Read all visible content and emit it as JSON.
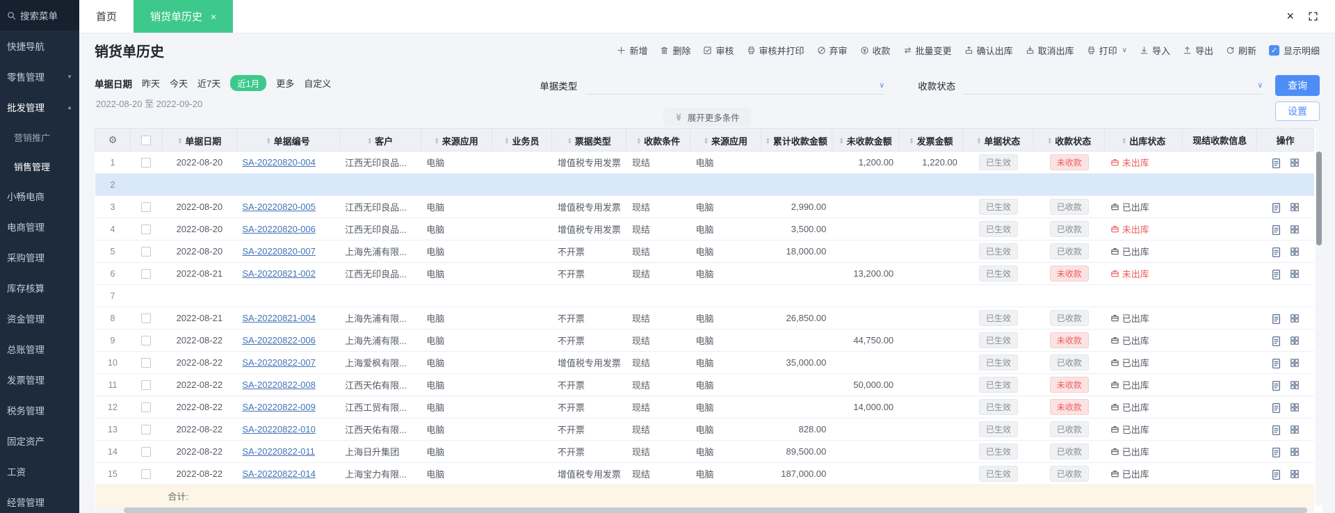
{
  "colors": {
    "green": "#3dc98c",
    "blue": "#4e8df6",
    "red": "#ef5d5d",
    "sidebar_bg": "#1e2b3c"
  },
  "sidebar": {
    "items": [
      {
        "name": "search-menu",
        "label": "搜索菜单",
        "icon": "search"
      },
      {
        "name": "quick-nav",
        "label": "快捷导航"
      },
      {
        "name": "retail-management",
        "label": "零售管理",
        "arrow": "down"
      },
      {
        "name": "wholesale-management",
        "label": "批发管理",
        "arrow": "up",
        "expanded": true
      },
      {
        "name": "marketing-promotion",
        "label": "营销推广",
        "sub": true
      },
      {
        "name": "sales-management",
        "label": "销售管理",
        "sub": true,
        "active": true
      },
      {
        "name": "xiaochang-ecommerce",
        "label": "小畅电商"
      },
      {
        "name": "ecommerce-management",
        "label": "电商管理"
      },
      {
        "name": "procurement-management",
        "label": "采购管理"
      },
      {
        "name": "inventory-accounting",
        "label": "库存核算"
      },
      {
        "name": "funds-management",
        "label": "资金管理"
      },
      {
        "name": "general-ledger",
        "label": "总账管理"
      },
      {
        "name": "invoice-management",
        "label": "发票管理"
      },
      {
        "name": "tax-management",
        "label": "税务管理"
      },
      {
        "name": "fixed-assets",
        "label": "固定资产"
      },
      {
        "name": "payroll",
        "label": "工资"
      },
      {
        "name": "business-management",
        "label": "经营管理"
      }
    ]
  },
  "tabs": {
    "home": "首页",
    "active": "销货单历史"
  },
  "page": {
    "title": "销货单历史",
    "toolbar": [
      {
        "name": "new",
        "label": "新增",
        "icon": "plus"
      },
      {
        "name": "delete",
        "label": "删除",
        "icon": "trash"
      },
      {
        "name": "audit",
        "label": "审核",
        "icon": "audit"
      },
      {
        "name": "audit-print",
        "label": "审核并打印",
        "icon": "audit-print"
      },
      {
        "name": "unaudit",
        "label": "弃审",
        "icon": "discard"
      },
      {
        "name": "receive-payment",
        "label": "收款",
        "icon": "money"
      },
      {
        "name": "batch-change",
        "label": "批量变更",
        "icon": "batch"
      },
      {
        "name": "confirm-outbound",
        "label": "确认出库",
        "icon": "outbound"
      },
      {
        "name": "cancel-outbound",
        "label": "取消出库",
        "icon": "cancel-outbound"
      },
      {
        "name": "print",
        "label": "打印",
        "icon": "printer",
        "dropdown": true
      },
      {
        "name": "import",
        "label": "导入",
        "icon": "import"
      },
      {
        "name": "export",
        "label": "导出",
        "icon": "export"
      },
      {
        "name": "refresh",
        "label": "刷新",
        "icon": "refresh"
      }
    ],
    "show_detail": "显示明细"
  },
  "filters": {
    "date_label": "单据日期",
    "quick_options": [
      {
        "name": "yesterday",
        "label": "昨天"
      },
      {
        "name": "today",
        "label": "今天"
      },
      {
        "name": "last-7-days",
        "label": "近7天"
      },
      {
        "name": "last-1-month",
        "label": "近1月",
        "active": true
      },
      {
        "name": "more",
        "label": "更多"
      },
      {
        "name": "custom",
        "label": "自定义"
      }
    ],
    "date_range": "2022-08-20 至 2022-09-20",
    "doc_type_label": "单据类型",
    "pay_status_label": "收款状态",
    "query_button": "查询",
    "settings_button": "设置",
    "expand_more": "展开更多条件"
  },
  "table": {
    "columns": [
      {
        "name": "doc-date",
        "label": "单据日期",
        "sortable": true
      },
      {
        "name": "doc-no",
        "label": "单据编号",
        "sortable": true
      },
      {
        "name": "customer",
        "label": "客户",
        "sortable": true
      },
      {
        "name": "source-app",
        "label": "来源应用",
        "sortable": true
      },
      {
        "name": "salesman",
        "label": "业务员",
        "sortable": true
      },
      {
        "name": "bill-type",
        "label": "票据类型",
        "sortable": true
      },
      {
        "name": "payment-terms",
        "label": "收款条件",
        "sortable": true
      },
      {
        "name": "source-app-2",
        "label": "来源应用",
        "sortable": true
      },
      {
        "name": "cumulative-received",
        "label": "累计收款金额",
        "sortable": true
      },
      {
        "name": "unreceived",
        "label": "未收款金额",
        "sortable": true
      },
      {
        "name": "invoice-amount",
        "label": "发票金额",
        "sortable": true
      },
      {
        "name": "doc-status",
        "label": "单据状态",
        "sortable": true
      },
      {
        "name": "pay-status",
        "label": "收款状态",
        "sortable": true
      },
      {
        "name": "outbound-status",
        "label": "出库状态",
        "sortable": true
      },
      {
        "name": "cash-info",
        "label": "现结收款信息",
        "sortable": false
      },
      {
        "name": "actions",
        "label": "操作",
        "sortable": false
      }
    ],
    "rows": [
      {
        "num": "1",
        "date": "2022-08-20",
        "no": "SA-20220820-004",
        "customer": "江西无印良品...",
        "source": "电脑",
        "bill": "增值税专用发票",
        "cond": "现结",
        "source2": "电脑",
        "unpaid": "1,200.00",
        "invoice": "1,220.00",
        "status": "已生效",
        "pay": "未收款",
        "pay_danger": true,
        "out": "未出库",
        "out_danger": true
      },
      {
        "num": "2",
        "empty": true,
        "selected": true
      },
      {
        "num": "3",
        "date": "2022-08-20",
        "no": "SA-20220820-005",
        "customer": "江西无印良品...",
        "source": "电脑",
        "bill": "增值税专用发票",
        "cond": "现结",
        "source2": "电脑",
        "cum": "2,990.00",
        "status": "已生效",
        "pay": "已收款",
        "out": "已出库"
      },
      {
        "num": "4",
        "date": "2022-08-20",
        "no": "SA-20220820-006",
        "customer": "江西无印良品...",
        "source": "电脑",
        "bill": "增值税专用发票",
        "cond": "现结",
        "source2": "电脑",
        "cum": "3,500.00",
        "status": "已生效",
        "pay": "已收款",
        "out": "未出库",
        "out_danger": true
      },
      {
        "num": "5",
        "date": "2022-08-20",
        "no": "SA-20220820-007",
        "customer": "上海先浦有限...",
        "source": "电脑",
        "bill": "不开票",
        "cond": "现结",
        "source2": "电脑",
        "cum": "18,000.00",
        "status": "已生效",
        "pay": "已收款",
        "out": "已出库"
      },
      {
        "num": "6",
        "date": "2022-08-21",
        "no": "SA-20220821-002",
        "customer": "江西无印良品...",
        "source": "电脑",
        "bill": "不开票",
        "cond": "现结",
        "source2": "电脑",
        "unpaid": "13,200.00",
        "status": "已生效",
        "pay": "未收款",
        "pay_danger": true,
        "out": "未出库",
        "out_danger": true
      },
      {
        "num": "7",
        "empty": true
      },
      {
        "num": "8",
        "date": "2022-08-21",
        "no": "SA-20220821-004",
        "customer": "上海先浦有限...",
        "source": "电脑",
        "bill": "不开票",
        "cond": "现结",
        "source2": "电脑",
        "cum": "26,850.00",
        "status": "已生效",
        "pay": "已收款",
        "out": "已出库"
      },
      {
        "num": "9",
        "date": "2022-08-22",
        "no": "SA-20220822-006",
        "customer": "上海先浦有限...",
        "source": "电脑",
        "bill": "不开票",
        "cond": "现结",
        "source2": "电脑",
        "unpaid": "44,750.00",
        "status": "已生效",
        "pay": "未收款",
        "pay_danger": true,
        "out": "已出库"
      },
      {
        "num": "10",
        "date": "2022-08-22",
        "no": "SA-20220822-007",
        "customer": "上海爱枫有限...",
        "source": "电脑",
        "bill": "增值税专用发票",
        "cond": "现结",
        "source2": "电脑",
        "cum": "35,000.00",
        "status": "已生效",
        "pay": "已收款",
        "out": "已出库"
      },
      {
        "num": "11",
        "date": "2022-08-22",
        "no": "SA-20220822-008",
        "customer": "江西天佑有限...",
        "source": "电脑",
        "bill": "不开票",
        "cond": "现结",
        "source2": "电脑",
        "unpaid": "50,000.00",
        "status": "已生效",
        "pay": "未收款",
        "pay_danger": true,
        "out": "已出库"
      },
      {
        "num": "12",
        "date": "2022-08-22",
        "no": "SA-20220822-009",
        "customer": "江西工贸有限...",
        "source": "电脑",
        "bill": "不开票",
        "cond": "现结",
        "source2": "电脑",
        "unpaid": "14,000.00",
        "status": "已生效",
        "pay": "未收款",
        "pay_danger": true,
        "out": "已出库"
      },
      {
        "num": "13",
        "date": "2022-08-22",
        "no": "SA-20220822-010",
        "customer": "江西天佑有限...",
        "source": "电脑",
        "bill": "不开票",
        "cond": "现结",
        "source2": "电脑",
        "cum": "828.00",
        "status": "已生效",
        "pay": "已收款",
        "out": "已出库"
      },
      {
        "num": "14",
        "date": "2022-08-22",
        "no": "SA-20220822-011",
        "customer": "上海日升集团",
        "source": "电脑",
        "bill": "不开票",
        "cond": "现结",
        "source2": "电脑",
        "cum": "89,500.00",
        "status": "已生效",
        "pay": "已收款",
        "out": "已出库"
      },
      {
        "num": "15",
        "date": "2022-08-22",
        "no": "SA-20220822-014",
        "customer": "上海宝力有限...",
        "source": "电脑",
        "bill": "增值税专用发票",
        "cond": "现结",
        "source2": "电脑",
        "cum": "187,000.00",
        "status": "已生效",
        "pay": "已收款",
        "out": "已出库"
      }
    ],
    "total_label": "合计:"
  }
}
